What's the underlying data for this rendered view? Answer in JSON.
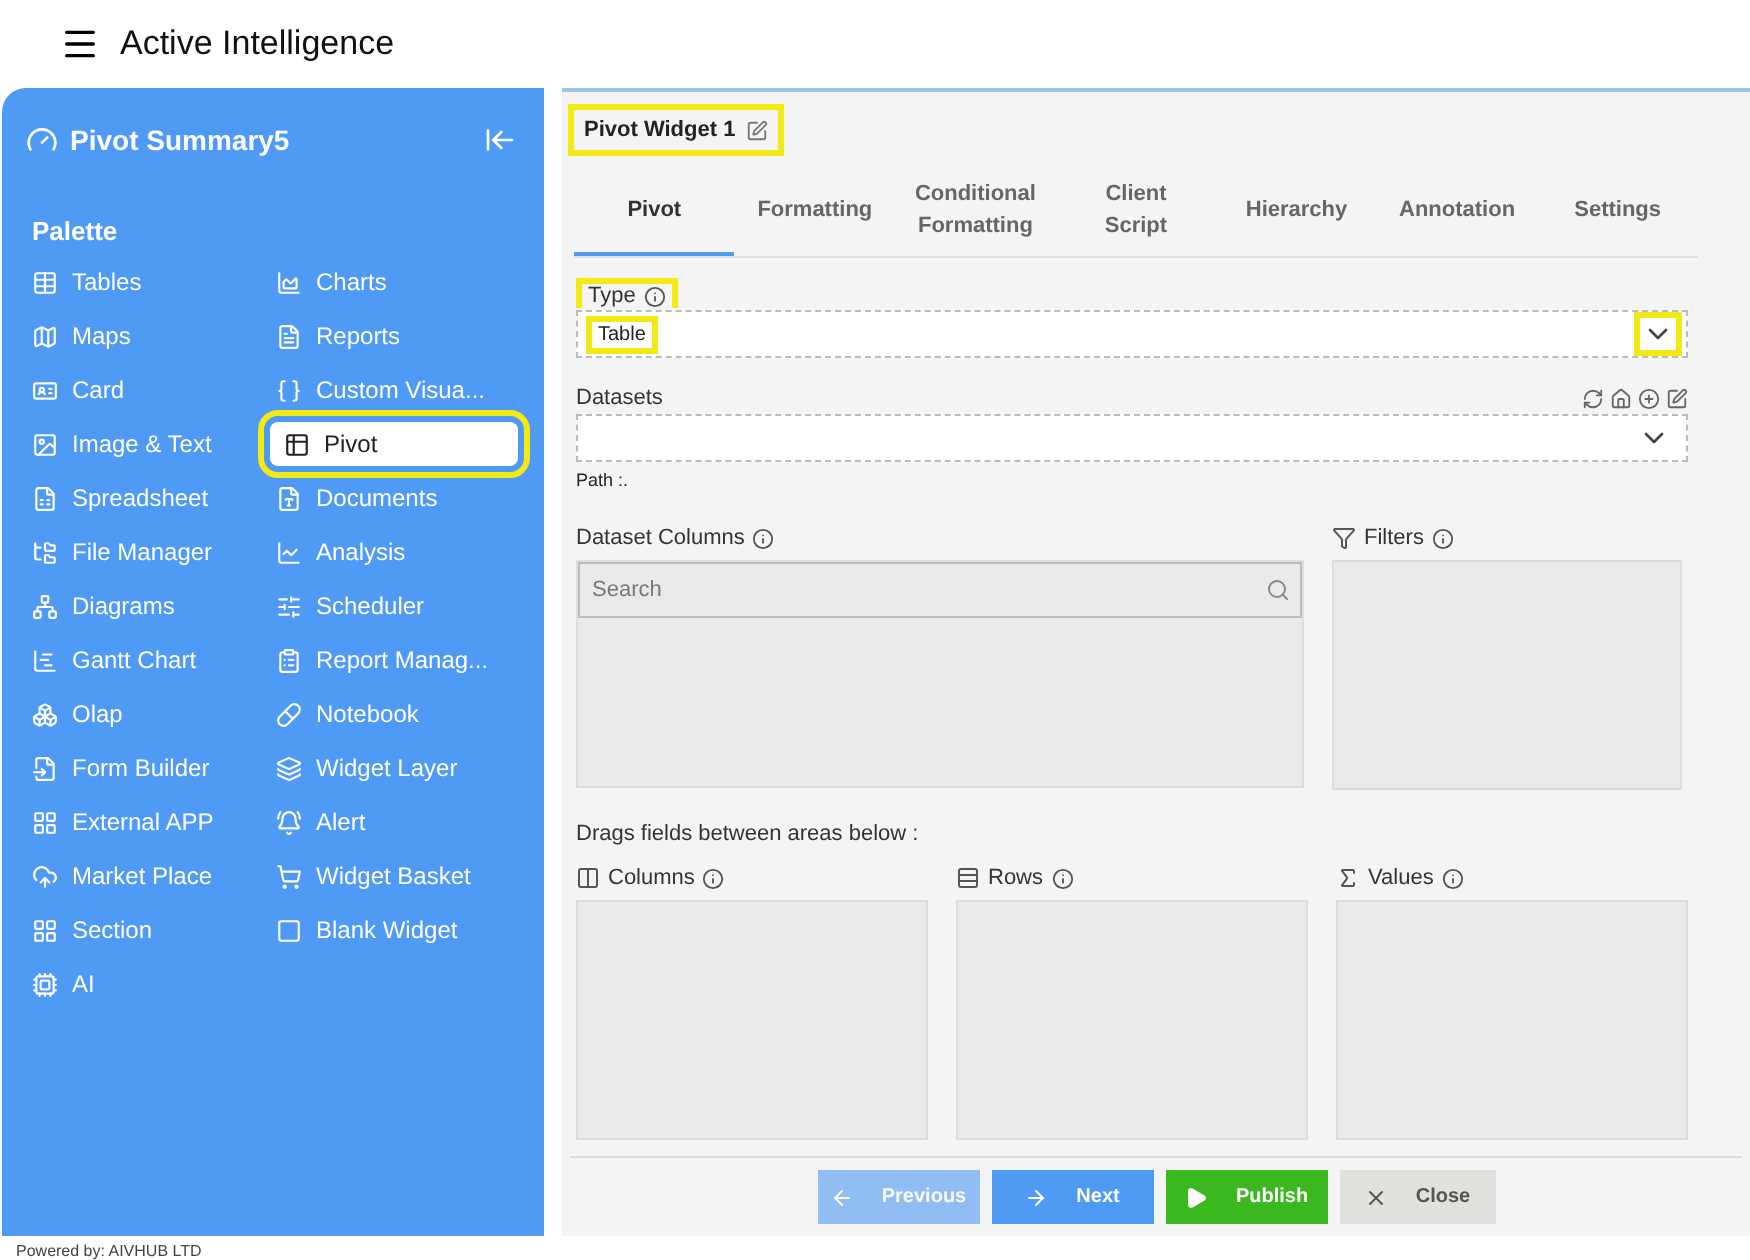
{
  "header": {
    "title": "Active Intelligence"
  },
  "sidebar": {
    "title": "Pivot Summary5",
    "section_label": "Palette",
    "items": [
      {
        "label": "Tables",
        "selected": false,
        "highlighted": false
      },
      {
        "label": "Charts",
        "selected": false,
        "highlighted": false
      },
      {
        "label": "Maps",
        "selected": false,
        "highlighted": false
      },
      {
        "label": "Reports",
        "selected": false,
        "highlighted": false
      },
      {
        "label": "Card",
        "selected": false,
        "highlighted": false
      },
      {
        "label": "Custom Visua...",
        "selected": false,
        "highlighted": false
      },
      {
        "label": "Image & Text",
        "selected": false,
        "highlighted": false
      },
      {
        "label": "Pivot",
        "selected": true,
        "highlighted": true
      },
      {
        "label": "Spreadsheet",
        "selected": false,
        "highlighted": false
      },
      {
        "label": "Documents",
        "selected": false,
        "highlighted": false
      },
      {
        "label": "File Manager",
        "selected": false,
        "highlighted": false
      },
      {
        "label": "Analysis",
        "selected": false,
        "highlighted": false
      },
      {
        "label": "Diagrams",
        "selected": false,
        "highlighted": false
      },
      {
        "label": "Scheduler",
        "selected": false,
        "highlighted": false
      },
      {
        "label": "Gantt Chart",
        "selected": false,
        "highlighted": false
      },
      {
        "label": "Report Manag...",
        "selected": false,
        "highlighted": false
      },
      {
        "label": "Olap",
        "selected": false,
        "highlighted": false
      },
      {
        "label": "Notebook",
        "selected": false,
        "highlighted": false
      },
      {
        "label": "Form Builder",
        "selected": false,
        "highlighted": false
      },
      {
        "label": "Widget Layer",
        "selected": false,
        "highlighted": false
      },
      {
        "label": "External APP",
        "selected": false,
        "highlighted": false
      },
      {
        "label": "Alert",
        "selected": false,
        "highlighted": false
      },
      {
        "label": "Market Place",
        "selected": false,
        "highlighted": false
      },
      {
        "label": "Widget Basket",
        "selected": false,
        "highlighted": false
      },
      {
        "label": "Section",
        "selected": false,
        "highlighted": false
      },
      {
        "label": "Blank Widget",
        "selected": false,
        "highlighted": false
      },
      {
        "label": "AI",
        "selected": false,
        "highlighted": false
      }
    ]
  },
  "footer": "Powered by: AIVHUB LTD",
  "widget": {
    "title": "Pivot Widget 1",
    "highlighted": true
  },
  "tabs": [
    {
      "label": "Pivot",
      "selected": true
    },
    {
      "label": "Formatting",
      "selected": false
    },
    {
      "label": "Conditional Formatting",
      "selected": false
    },
    {
      "label": "Client Script",
      "selected": false
    },
    {
      "label": "Hierarchy",
      "selected": false
    },
    {
      "label": "Annotation",
      "selected": false
    },
    {
      "label": "Settings",
      "selected": false
    }
  ],
  "form": {
    "type": {
      "label": "Type",
      "value": "Table",
      "highlighted": true,
      "chevron_highlighted": true
    },
    "datasets": {
      "label": "Datasets"
    },
    "path": "Path :.",
    "dataset_columns": {
      "label": "Dataset Columns",
      "search_placeholder": "Search"
    },
    "filters": {
      "label": "Filters"
    },
    "drag_hint": "Drags fields between areas below :",
    "areas": [
      {
        "label": "Columns"
      },
      {
        "label": "Rows"
      },
      {
        "label": "Values"
      }
    ]
  },
  "buttons": [
    {
      "label": "Previous",
      "kind": "previous",
      "disabled": true
    },
    {
      "label": "Next",
      "kind": "next",
      "disabled": false
    },
    {
      "label": "Publish",
      "kind": "publish",
      "disabled": false
    },
    {
      "label": "Close",
      "kind": "close",
      "disabled": false
    }
  ]
}
